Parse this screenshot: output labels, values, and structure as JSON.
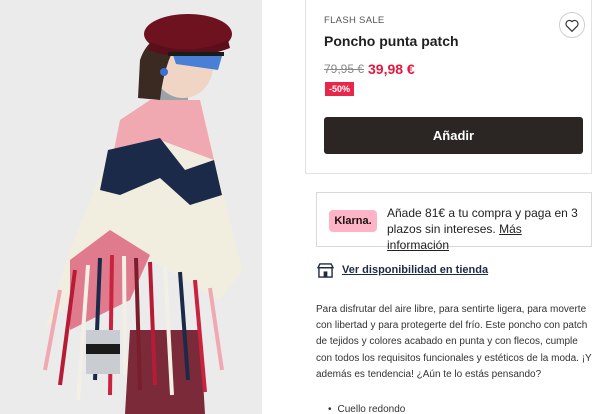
{
  "product": {
    "flash_label": "FLASH SALE",
    "title": "Poncho punta patch",
    "old_price": "79,95 €",
    "new_price": "39,98 €",
    "discount": "-50%",
    "add_button": "Añadir",
    "favorite_icon": "heart-icon"
  },
  "klarna": {
    "logo": "Klarna.",
    "text": "Añade 81€ a tu compra y paga en 3 plazos sin intereses.",
    "link": "Más información"
  },
  "store": {
    "icon": "store-icon",
    "link": "Ver disponibilidad en tienda"
  },
  "description": {
    "text": "Para disfrutar del aire libre, para sentirte ligera, para moverte con libertad y para protegerte del frío. Este poncho con patch de tejidos y colores acabado en punta y con flecos, cumple con todos los requisitos funcionales y estéticos de la moda. ¡Y además es tendencia! ¿Aún te lo estás pensando?",
    "bullet": "Cuello redondo"
  },
  "colors": {
    "accent_red": "#e5173f",
    "button_dark": "#2b2624",
    "klarna_pink": "#ffb3c7"
  }
}
